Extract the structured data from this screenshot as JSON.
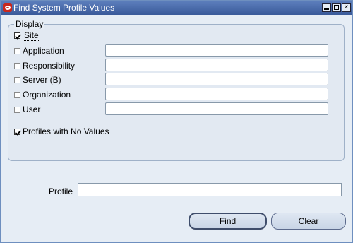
{
  "window": {
    "title": "Find System Profile Values"
  },
  "display": {
    "title": "Display",
    "options": [
      {
        "label": "Site",
        "checked": true,
        "has_field": false
      },
      {
        "label": "Application",
        "checked": false,
        "has_field": true,
        "value": ""
      },
      {
        "label": "Responsibility",
        "checked": false,
        "has_field": true,
        "value": ""
      },
      {
        "label": "Server (B)",
        "checked": false,
        "has_field": true,
        "value": ""
      },
      {
        "label": "Organization",
        "checked": false,
        "has_field": true,
        "value": ""
      },
      {
        "label": "User",
        "checked": false,
        "has_field": true,
        "value": ""
      }
    ],
    "profiles_no_values": {
      "label": "Profiles with No Values",
      "checked": true
    }
  },
  "profile": {
    "label": "Profile",
    "value": ""
  },
  "buttons": {
    "find": "Find",
    "clear": "Clear"
  },
  "colors": {
    "titlebar": "#3a5a9a",
    "background": "#e6edf5",
    "app_icon": "#c8281e"
  }
}
